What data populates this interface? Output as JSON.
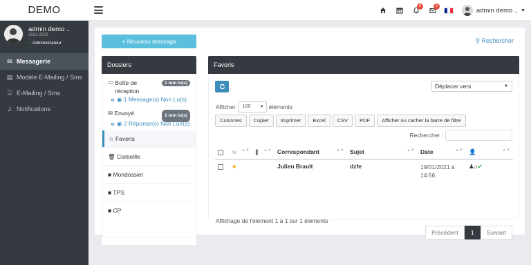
{
  "brand": "DEMO",
  "header": {
    "notif_badge_1": "0",
    "notif_badge_2": "0",
    "flag_colors": [
      "#002395",
      "#ffffff",
      "#ed2939"
    ],
    "user_label": "admin demo .."
  },
  "sidebar": {
    "profile": {
      "name": "admin demo ..",
      "year": "2022-2023",
      "role": "Administrateur"
    },
    "items": [
      {
        "label": "Messagerie",
        "icon": "envelope-icon",
        "active": true
      },
      {
        "label": "Modèle E-Mailing / Sms",
        "icon": "template-icon",
        "active": false
      },
      {
        "label": "E-Mailing / Sms",
        "icon": "inbox-icon",
        "active": false
      },
      {
        "label": "Notifications",
        "icon": "bell-icon",
        "active": false
      }
    ]
  },
  "main": {
    "new_message": "+ Nouveau message",
    "search_link": "Rechercher"
  },
  "folders": {
    "title": "Dossiers",
    "inbox": {
      "label": "Boîte de réception",
      "badge": "1 non lu(s)",
      "sub": "1 Message(s) Non Lu(s)"
    },
    "sent": {
      "label": "Envoyé",
      "badge": "2 non lu(s)",
      "sub": "2 Réponse(s) Non Lue(s)"
    },
    "items": [
      "Favoris",
      "Corbeille",
      "Mondossier",
      "TPS",
      "CP"
    ]
  },
  "favoris": {
    "title": "Favoris",
    "move_select": "Déplacer vers",
    "show_label": "Afficher",
    "page_size": "100",
    "elements_label": "éléments",
    "buttons": [
      "Colonnes",
      "Copier",
      "Imprimer",
      "Excel",
      "CSV",
      "PDF",
      "Afficher ou cacher la barre de filtre"
    ],
    "search_label": "Rechercher :",
    "columns": {
      "correspondant": "Correspondant",
      "sujet": "Sujet",
      "date": "Date"
    },
    "rows": [
      {
        "correspondant": "Julien Brault",
        "sujet": "dzfe",
        "date": "19/01/2021 à 14:56",
        "starred": true
      }
    ],
    "info": "Affichage de l'élement 1 à 1 sur 1 éléments",
    "pager": {
      "prev": "Précédent",
      "current": "1",
      "next": "Suivant"
    },
    "accent": "#3c8dbc",
    "star_color": "#f0a30a"
  }
}
